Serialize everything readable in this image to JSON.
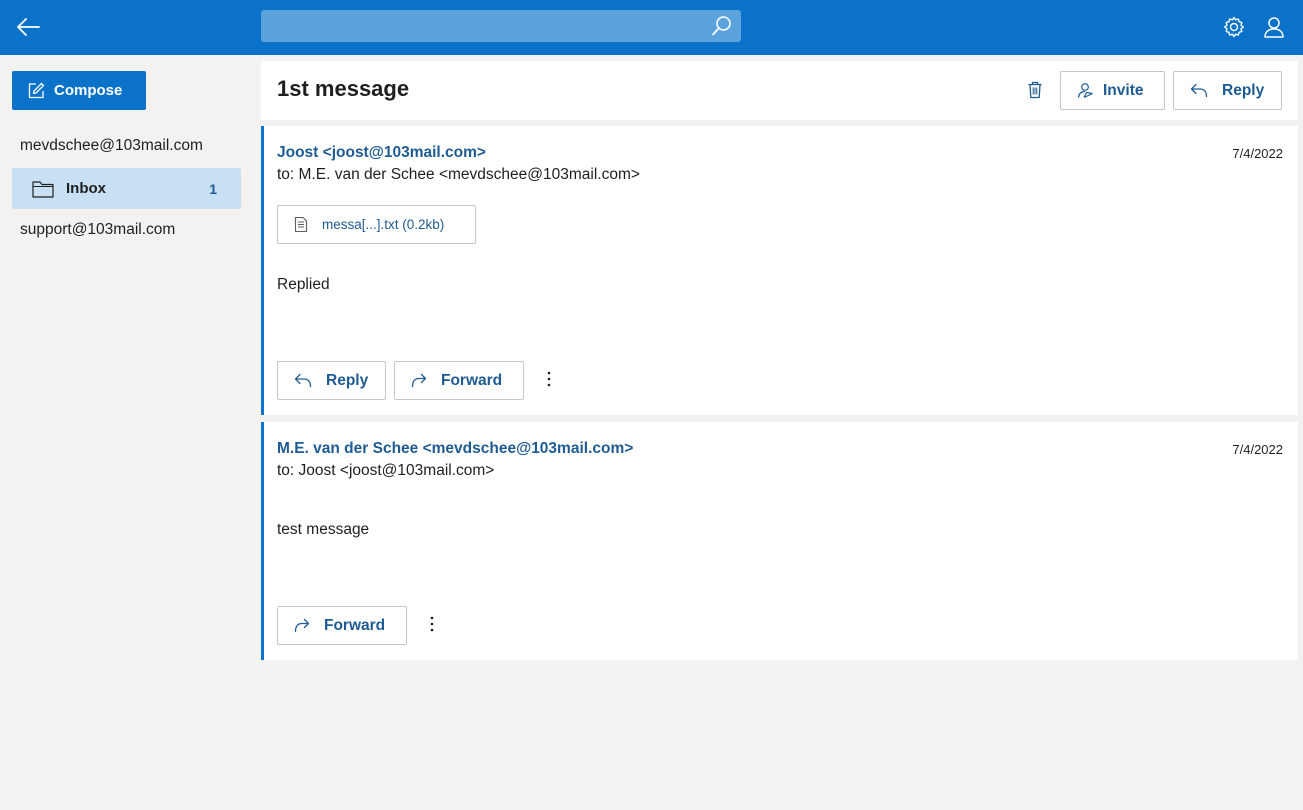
{
  "search": {
    "placeholder": ""
  },
  "sidebar": {
    "compose_label": "Compose",
    "accounts": [
      {
        "email": "mevdschee@103mail.com"
      },
      {
        "email": "support@103mail.com"
      }
    ],
    "folder": {
      "name": "Inbox",
      "count": "1"
    }
  },
  "thread": {
    "subject": "1st message",
    "invite_label": "Invite",
    "reply_label": "Reply"
  },
  "messages": [
    {
      "from": "Joost <joost@103mail.com>",
      "to": "to: M.E. van der Schee <mevdschee@103mail.com>",
      "date": "7/4/2022",
      "attachment": "messa[...].txt (0.2kb)",
      "body": "Replied",
      "reply_label": "Reply",
      "forward_label": "Forward"
    },
    {
      "from": "M.E. van der Schee <mevdschee@103mail.com>",
      "to": "to: Joost <joost@103mail.com>",
      "date": "7/4/2022",
      "body": "test message",
      "forward_label": "Forward"
    }
  ],
  "colors": {
    "brand": "#0a73c9",
    "link": "#1f5b93",
    "selected": "#c7e0f4",
    "background": "#f3f2f1"
  },
  "icons": [
    "back-arrow-icon",
    "search-icon",
    "gear-icon",
    "user-icon",
    "edit-icon",
    "folder-icon",
    "trash-icon",
    "invite-icon",
    "reply-icon",
    "forward-icon",
    "document-icon",
    "more-vertical-icon"
  ]
}
